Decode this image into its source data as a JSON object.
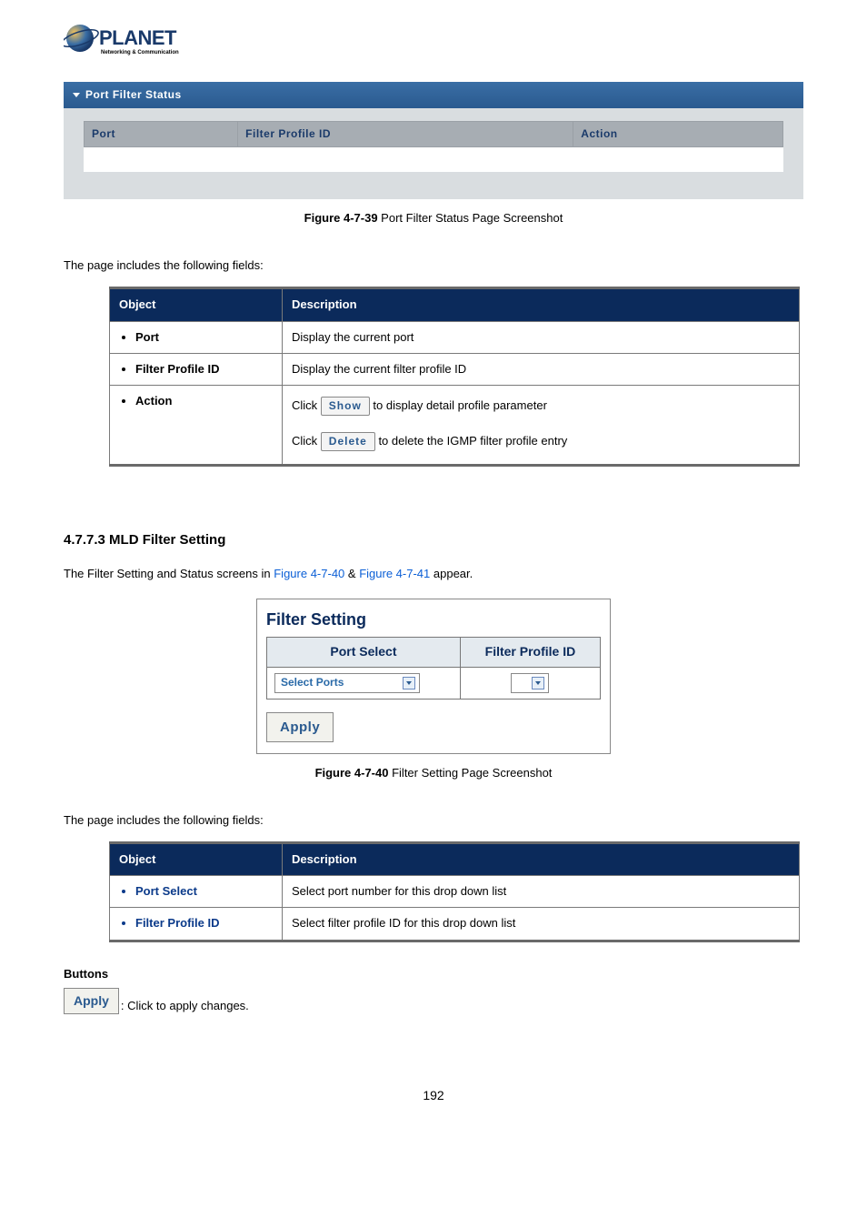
{
  "logo": {
    "brand": "PLANET",
    "tagline": "Networking & Communication"
  },
  "panel1": {
    "title": "Port Filter Status",
    "cols": [
      "Port",
      "Filter Profile ID",
      "Action"
    ]
  },
  "fig1": {
    "label": "Figure 4-7-39",
    "text": " Port Filter Status Page Screenshot"
  },
  "intro": "The page includes the following fields:",
  "table1": {
    "head": [
      "Object",
      "Description"
    ],
    "rows": [
      {
        "obj": "Port",
        "desc": "Display the current port"
      },
      {
        "obj": "Filter Profile ID",
        "desc": "Display the current filter profile ID"
      }
    ],
    "actionRow": {
      "obj": "Action",
      "p1_a": "Click ",
      "btn1": "Show",
      "p1_b": " to display detail profile parameter",
      "p2_a": "Click ",
      "btn2": "Delete",
      "p2_b": " to delete the IGMP filter profile entry"
    }
  },
  "section": "4.7.7.3 MLD Filter Setting",
  "refline": {
    "a": "The Filter Setting and Status screens in ",
    "l1": "Figure 4-7-40",
    "mid": " & ",
    "l2": "Figure 4-7-41",
    "b": " appear."
  },
  "filterShot": {
    "title": "Filter Setting",
    "cols": [
      "Port Select",
      "Filter Profile ID"
    ],
    "selectText": "Select Ports",
    "apply": "Apply"
  },
  "fig2": {
    "label": "Figure 4-7-40",
    "text": " Filter Setting Page Screenshot"
  },
  "table2": {
    "head": [
      "Object",
      "Description"
    ],
    "rows": [
      {
        "obj": "Port Select",
        "desc": "Select port number for this drop down list"
      },
      {
        "obj": "Filter Profile ID",
        "desc": "Select filter profile ID for this drop down list"
      }
    ]
  },
  "buttonsHeading": "Buttons",
  "applyLine": {
    "btn": "Apply",
    "text": ": Click to apply changes."
  },
  "pageNumber": "192"
}
